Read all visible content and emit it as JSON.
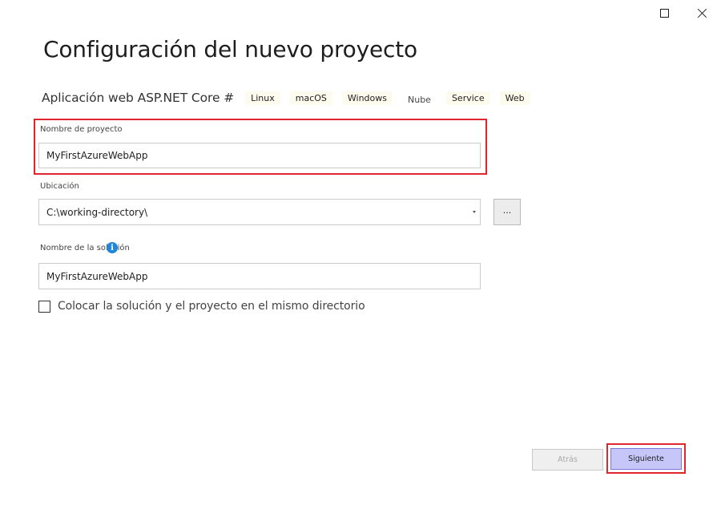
{
  "window": {
    "maximize_icon": "maximize-icon",
    "close_icon": "close-icon"
  },
  "page": {
    "title": "Configuración del nuevo proyecto"
  },
  "template": {
    "name": "Aplicación web ASP.NET Core #",
    "tags": [
      "Linux",
      "macOS",
      "Windows",
      "Nube",
      "Service",
      "Web"
    ]
  },
  "project_name": {
    "label": "Nombre de proyecto",
    "value": "MyFirstAzureWebApp"
  },
  "location": {
    "label": "Ubicación",
    "value": "C:\\working-directory\\",
    "browse_label": "..."
  },
  "solution_name": {
    "label": "Nombre de la solución",
    "value": "MyFirstAzureWebApp",
    "info_icon_glyph": "i"
  },
  "same_directory": {
    "label": "Colocar la solución y el proyecto en el mismo directorio",
    "checked": false
  },
  "footer": {
    "back_label": "Atrás",
    "next_label": "Siguiente"
  },
  "colors": {
    "highlight": "#e0262f",
    "primary_button": "#c6c6f8",
    "info": "#1f86d9"
  }
}
